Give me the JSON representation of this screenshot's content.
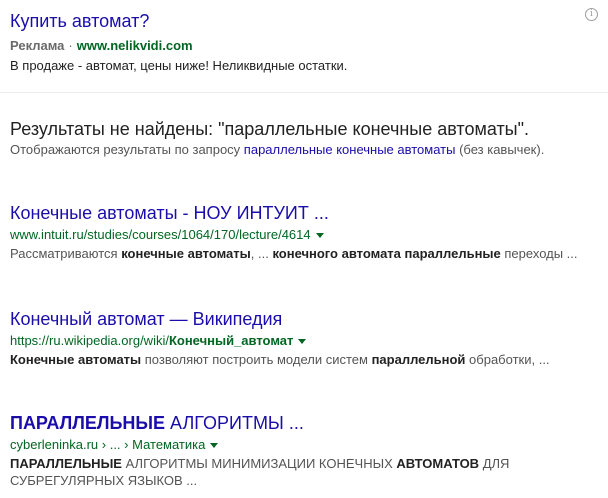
{
  "ad": {
    "title": "Купить автомат?",
    "label": "Реклама",
    "separator": "·",
    "url": "www.nelikvidi.com",
    "description": "В продаже - автомат, цены ниже! Неликвидные остатки.",
    "info_icon": "info-icon"
  },
  "no_results": {
    "heading": "Результаты не найдены: \"параллельные конечные автоматы\".",
    "sub_prefix": "Отображаются результаты по запросу ",
    "sub_link": "параллельные конечные автоматы",
    "sub_suffix": " (без кавычек)."
  },
  "results": [
    {
      "title_bold": "Конечные автоматы",
      "title_rest": " - НОУ ИНТУИТ ...",
      "url": "www.intuit.ru/studies/courses/1064/170/lecture/4614",
      "snippet_1": "Рассматриваются ",
      "snippet_b1": "конечные автоматы",
      "snippet_2": ", ... ",
      "snippet_b2": "конечного автомата параллельные",
      "snippet_3": " переходы ..."
    },
    {
      "title_bold": "Конечный автомат",
      "title_rest": " — Википедия",
      "url_plain": "https://ru.wikipedia.org/wiki/",
      "url_bold": "Конечный_автомат",
      "snippet_b1": "Конечные автоматы",
      "snippet_2": " позволяют построить модели систем ",
      "snippet_b2": "параллельной",
      "snippet_3": " обработки, ..."
    },
    {
      "title_bold": "ПАРАЛЛЕЛЬНЫЕ",
      "title_rest": " АЛГОРИТМЫ ...",
      "url": "cyberleninka.ru › ... › Математика",
      "snippet_b1": "ПАРАЛЛЕЛЬНЫЕ",
      "snippet_2": " АЛГОРИТМЫ МИНИМИЗАЦИИ КОНЕЧНЫХ ",
      "snippet_b2": "АВТОМАТОВ",
      "snippet_3": " ДЛЯ СУБРЕГУЛЯРНЫХ ЯЗЫКОВ ..."
    }
  ],
  "colors": {
    "link": "#1a0dab",
    "url_green": "#006621",
    "snippet": "#545454",
    "text": "#222222"
  }
}
